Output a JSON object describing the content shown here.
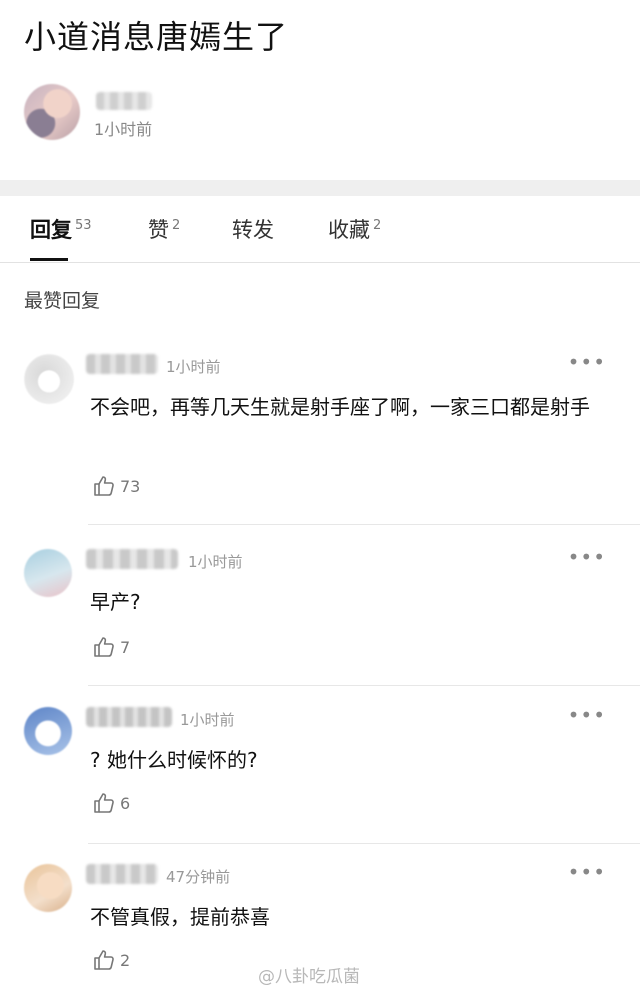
{
  "post": {
    "title": "小道消息唐嫣生了",
    "author_time": "1小时前"
  },
  "tabs": [
    {
      "label": "回复",
      "count": "53"
    },
    {
      "label": "赞",
      "count": "2"
    },
    {
      "label": "转发",
      "count": ""
    },
    {
      "label": "收藏",
      "count": "2"
    }
  ],
  "section_label": "最赞回复",
  "comments": [
    {
      "time": "1小时前",
      "text": "不会吧，再等几天生就是射手座了啊，一家三口都是射手",
      "likes": "73"
    },
    {
      "time": "1小时前",
      "text": "早产?",
      "likes": "7"
    },
    {
      "time": "1小时前",
      "text": "? 她什么时候怀的?",
      "likes": "6"
    },
    {
      "time": "47分钟前",
      "text": "不管真假，提前恭喜",
      "likes": "2"
    }
  ],
  "more_glyph": "•••",
  "watermark": "@八卦吃瓜菌",
  "colors": {
    "accent": "#111111",
    "muted": "#999999",
    "band": "#efefef"
  }
}
